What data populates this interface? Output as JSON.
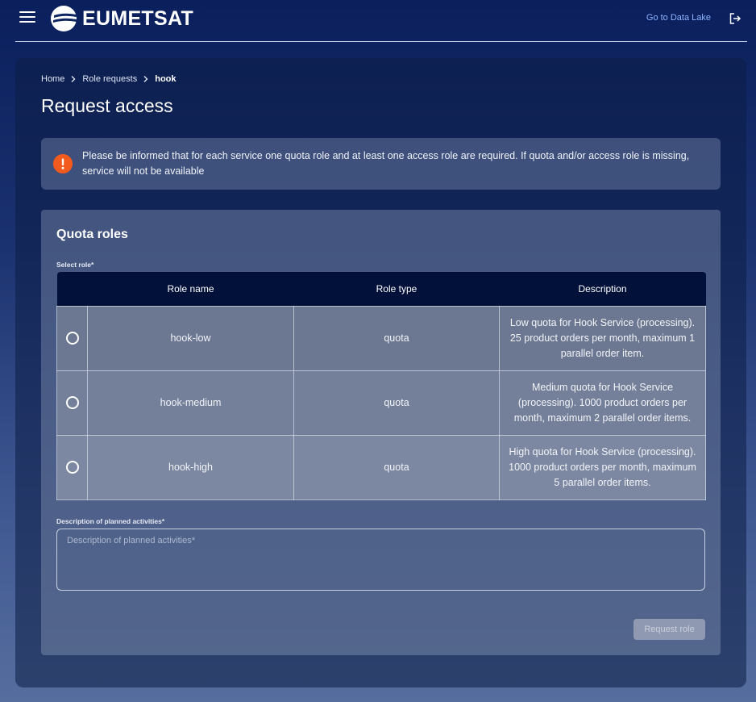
{
  "header": {
    "brand": "EUMETSAT",
    "datalake_link": "Go to Data Lake",
    "menu_icon": "hamburger-menu-icon",
    "logout_icon": "logout-icon"
  },
  "breadcrumb": {
    "items": [
      "Home",
      "Role requests",
      "hook"
    ]
  },
  "page": {
    "title": "Request access"
  },
  "info": {
    "icon": "info-icon",
    "text": "Please be informed that for each service one quota role and at least one access role are required. If quota and/or access role is missing, service will not be available"
  },
  "quota": {
    "title": "Quota roles",
    "select_label": "Select role*",
    "columns": [
      "",
      "Role name",
      "Role type",
      "Description"
    ],
    "rows": [
      {
        "name": "hook-low",
        "type": "quota",
        "description": "Low quota for Hook Service (processing). 25 product orders per month, maximum 1 parallel order item."
      },
      {
        "name": "hook-medium",
        "type": "quota",
        "description": "Medium quota for Hook Service (processing). 1000 product orders per month, maximum 2 parallel order items."
      },
      {
        "name": "hook-high",
        "type": "quota",
        "description": "High quota for Hook Service (processing). 1000 product orders per month, maximum 5 parallel order items."
      }
    ],
    "description_label": "Description of planned activities*",
    "description_placeholder": "Description of planned activities*",
    "description_value": "",
    "submit_label": "Request role"
  },
  "colors": {
    "accent": "#f25a1e",
    "link": "#8fb4ff",
    "table_header": "#021139"
  }
}
